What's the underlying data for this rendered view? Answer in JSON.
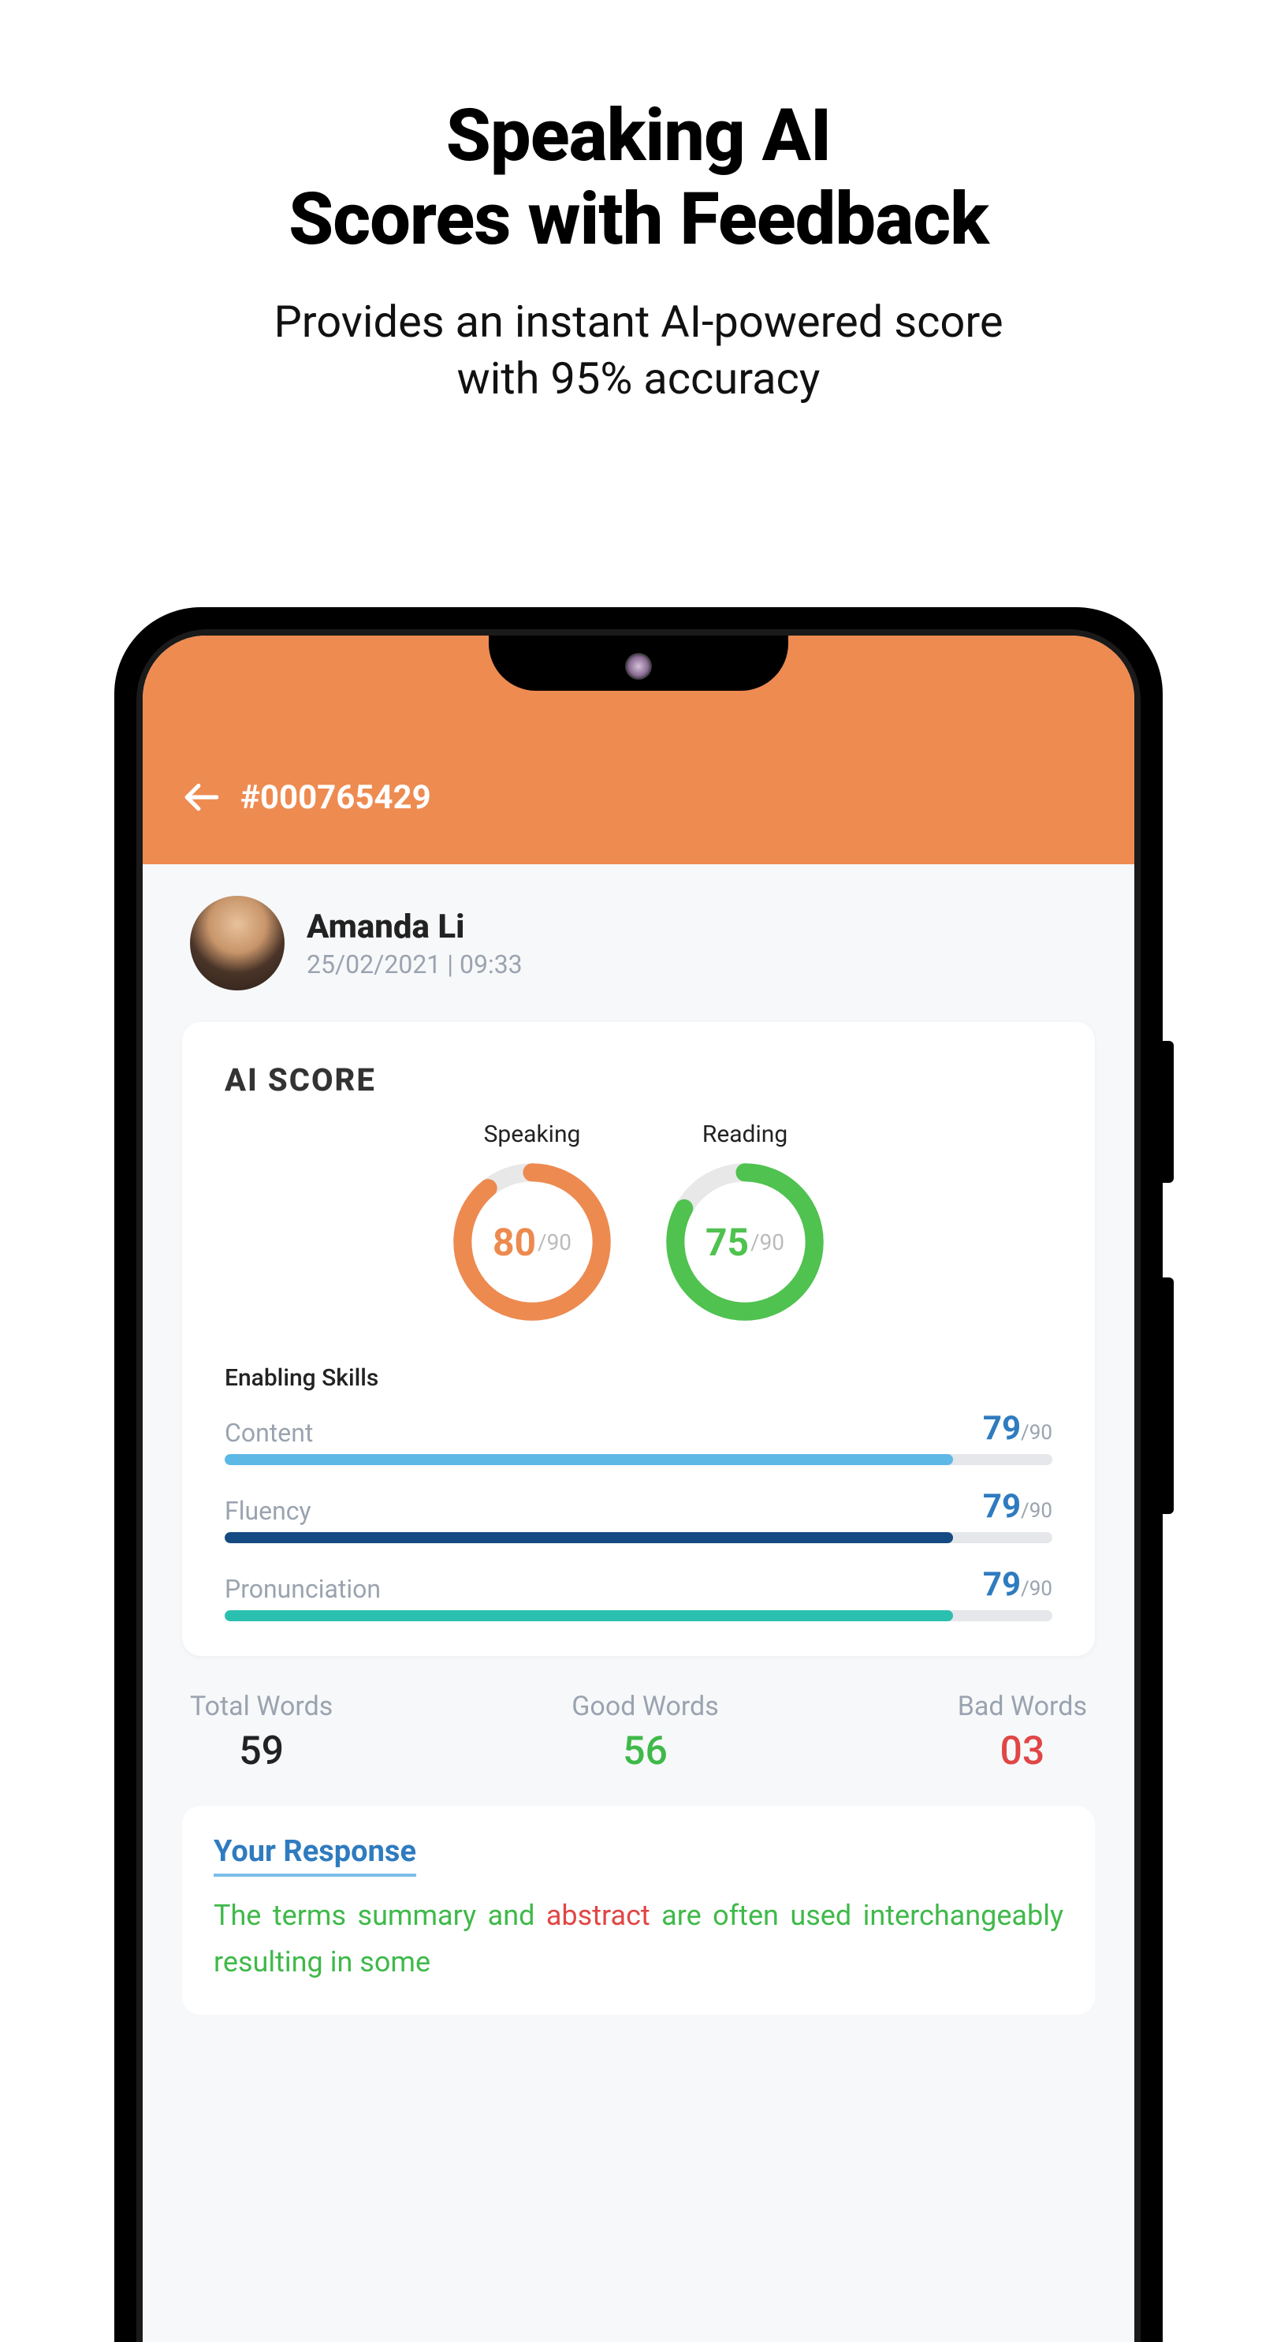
{
  "promo": {
    "title_line1": "Speaking AI",
    "title_line2": "Scores with Feedback",
    "subtitle_line1": "Provides an instant AI-powered score",
    "subtitle_line2": "with 95% accuracy"
  },
  "header": {
    "session_id": "#000765429"
  },
  "user": {
    "name": "Amanda Li",
    "datetime": "25/02/2021 | 09:33"
  },
  "score_card": {
    "title": "AI SCORE",
    "gauges": [
      {
        "label": "Speaking",
        "value": "80",
        "max": "/90",
        "color": "#ed8a50",
        "percent": 89
      },
      {
        "label": "Reading",
        "value": "75",
        "max": "/90",
        "color": "#4fc24f",
        "percent": 83
      }
    ],
    "skills_heading": "Enabling Skills",
    "skills": [
      {
        "name": "Content",
        "value": "79",
        "max": "/90",
        "fill": 88,
        "color": "#5eb8e6"
      },
      {
        "name": "Fluency",
        "value": "79",
        "max": "/90",
        "fill": 88,
        "color": "#154a82"
      },
      {
        "name": "Pronunciation",
        "value": "79",
        "max": "/90",
        "fill": 88,
        "color": "#2bbfb0"
      }
    ]
  },
  "stats": {
    "total": {
      "label": "Total Words",
      "value": "59"
    },
    "good": {
      "label": "Good Words",
      "value": "56"
    },
    "bad": {
      "label": "Bad Words",
      "value": "03"
    }
  },
  "response": {
    "title": "Your Response",
    "text_1": "The terms summary and ",
    "text_bad": "abstract",
    "text_2": " are often used interchangeably resulting in some"
  },
  "chart_data": [
    {
      "type": "pie",
      "title": "Speaking",
      "values": [
        80,
        10
      ],
      "max": 90,
      "color": "#ed8a50"
    },
    {
      "type": "pie",
      "title": "Reading",
      "values": [
        75,
        15
      ],
      "max": 90,
      "color": "#4fc24f"
    },
    {
      "type": "bar",
      "title": "Enabling Skills",
      "categories": [
        "Content",
        "Fluency",
        "Pronunciation"
      ],
      "values": [
        79,
        79,
        79
      ],
      "ylim": [
        0,
        90
      ]
    }
  ]
}
